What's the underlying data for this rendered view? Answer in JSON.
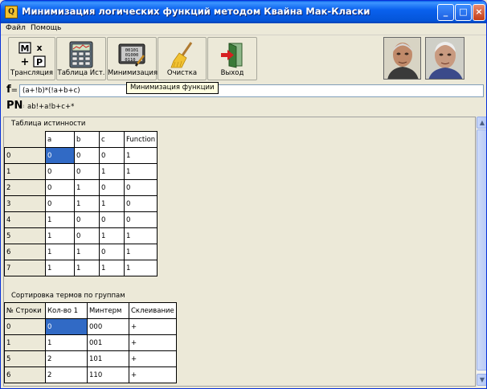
{
  "window": {
    "title": "Минимизация логических функций методом Квайна Мак-Класки",
    "buttons": {
      "minimize": "_",
      "maximize": "□",
      "close": "×"
    }
  },
  "menu": [
    "Файл",
    "Помощь"
  ],
  "toolbar": {
    "items": [
      {
        "label": "Трансляция",
        "icon": "mx-plus-p-icon"
      },
      {
        "label": "Таблица Ист.",
        "icon": "calculator-table-icon"
      },
      {
        "label": "Минимизация",
        "icon": "binary-display-icon"
      },
      {
        "label": "Очистка",
        "icon": "broom-icon"
      },
      {
        "label": "Выход",
        "icon": "exit-door-icon"
      }
    ],
    "mx_icon_letters": [
      "M",
      "x",
      "+",
      "P"
    ],
    "binary_lines": [
      "00101",
      "01000",
      "0110"
    ]
  },
  "tooltip": "Минимизация функции",
  "formula": {
    "f_label": "f",
    "f_eq": "=",
    "f_value": "(a+!b)*(!a+b+c)",
    "pn_label": "PN",
    "pn_eq": "=",
    "pn_value": "ab!+a!b+c+*"
  },
  "truth_table": {
    "caption": "Таблица истинности",
    "headers": [
      "a",
      "b",
      "c",
      "Function"
    ],
    "rows": [
      {
        "index": "0",
        "values": [
          "0",
          "0",
          "0",
          "1"
        ]
      },
      {
        "index": "1",
        "values": [
          "0",
          "0",
          "1",
          "1"
        ]
      },
      {
        "index": "2",
        "values": [
          "0",
          "1",
          "0",
          "0"
        ]
      },
      {
        "index": "3",
        "values": [
          "0",
          "1",
          "1",
          "0"
        ]
      },
      {
        "index": "4",
        "values": [
          "1",
          "0",
          "0",
          "0"
        ]
      },
      {
        "index": "5",
        "values": [
          "1",
          "0",
          "1",
          "1"
        ]
      },
      {
        "index": "6",
        "values": [
          "1",
          "1",
          "0",
          "1"
        ]
      },
      {
        "index": "7",
        "values": [
          "1",
          "1",
          "1",
          "1"
        ]
      }
    ]
  },
  "sort_table": {
    "caption": "Сортировка термов по группам",
    "headers": [
      "№ Строки",
      "Кол-во 1",
      "Минтерм",
      "Склеивание"
    ],
    "rows": [
      {
        "index": "0",
        "values": [
          "0",
          "000",
          "+"
        ]
      },
      {
        "index": "1",
        "values": [
          "1",
          "001",
          "+"
        ]
      },
      {
        "index": "5",
        "values": [
          "2",
          "101",
          "+"
        ]
      },
      {
        "index": "6",
        "values": [
          "2",
          "110",
          "+"
        ]
      }
    ]
  },
  "scrollbar": {
    "up": "▲",
    "down": "▼"
  }
}
